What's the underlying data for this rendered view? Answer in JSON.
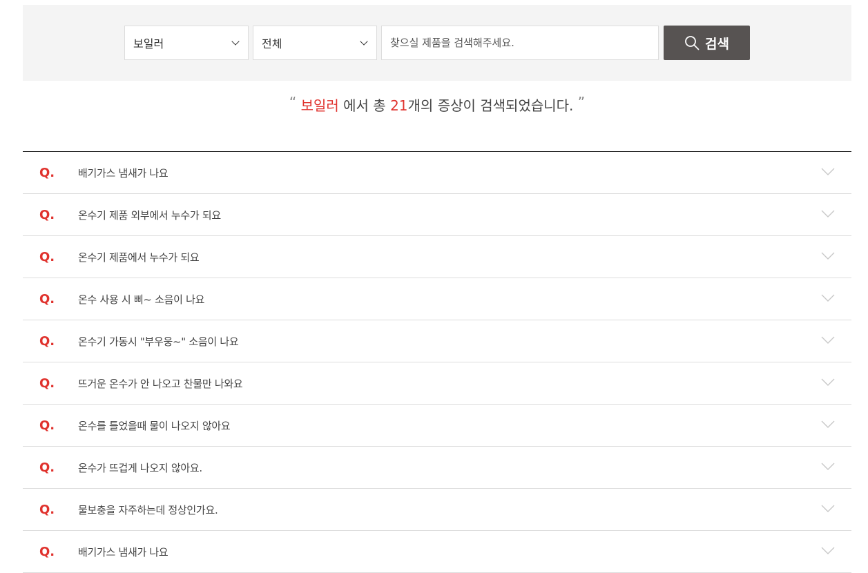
{
  "search": {
    "category_value": "보일러",
    "subcategory_value": "전체",
    "input_placeholder": "찾으실 제품을 검색해주세요.",
    "input_value": "",
    "button_label": "검색"
  },
  "summary": {
    "open_quote": "“",
    "category": "보일러",
    "middle_text": " 에서 총 ",
    "count": "21",
    "suffix_text": "개의 증상이 검색되었습니다.",
    "close_quote": "”"
  },
  "faq": {
    "q_marker": "Q.",
    "items": [
      {
        "question": "배기가스 냄새가 나요"
      },
      {
        "question": "온수기 제품 외부에서 누수가 되요"
      },
      {
        "question": "온수기 제품에서 누수가 되요"
      },
      {
        "question": "온수 사용 시 삐~ 소음이 나요"
      },
      {
        "question": "온수기 가동시 \"부우웅~\" 소음이 나요"
      },
      {
        "question": "뜨거운 온수가 안 나오고 찬물만 나와요"
      },
      {
        "question": "온수를 틀었을때 물이 나오지 않아요"
      },
      {
        "question": "온수가 뜨겁게 나오지 않아요."
      },
      {
        "question": "물보충을 자주하는데 정상인가요."
      },
      {
        "question": "배기가스 냄새가 나요"
      }
    ]
  },
  "colors": {
    "accent": "#e0322d",
    "button": "#575352",
    "panel": "#f4f4f4"
  },
  "icons": {
    "search": "search-icon",
    "chevron": "chevron-down-icon",
    "select_caret": "chevron-down-icon"
  }
}
